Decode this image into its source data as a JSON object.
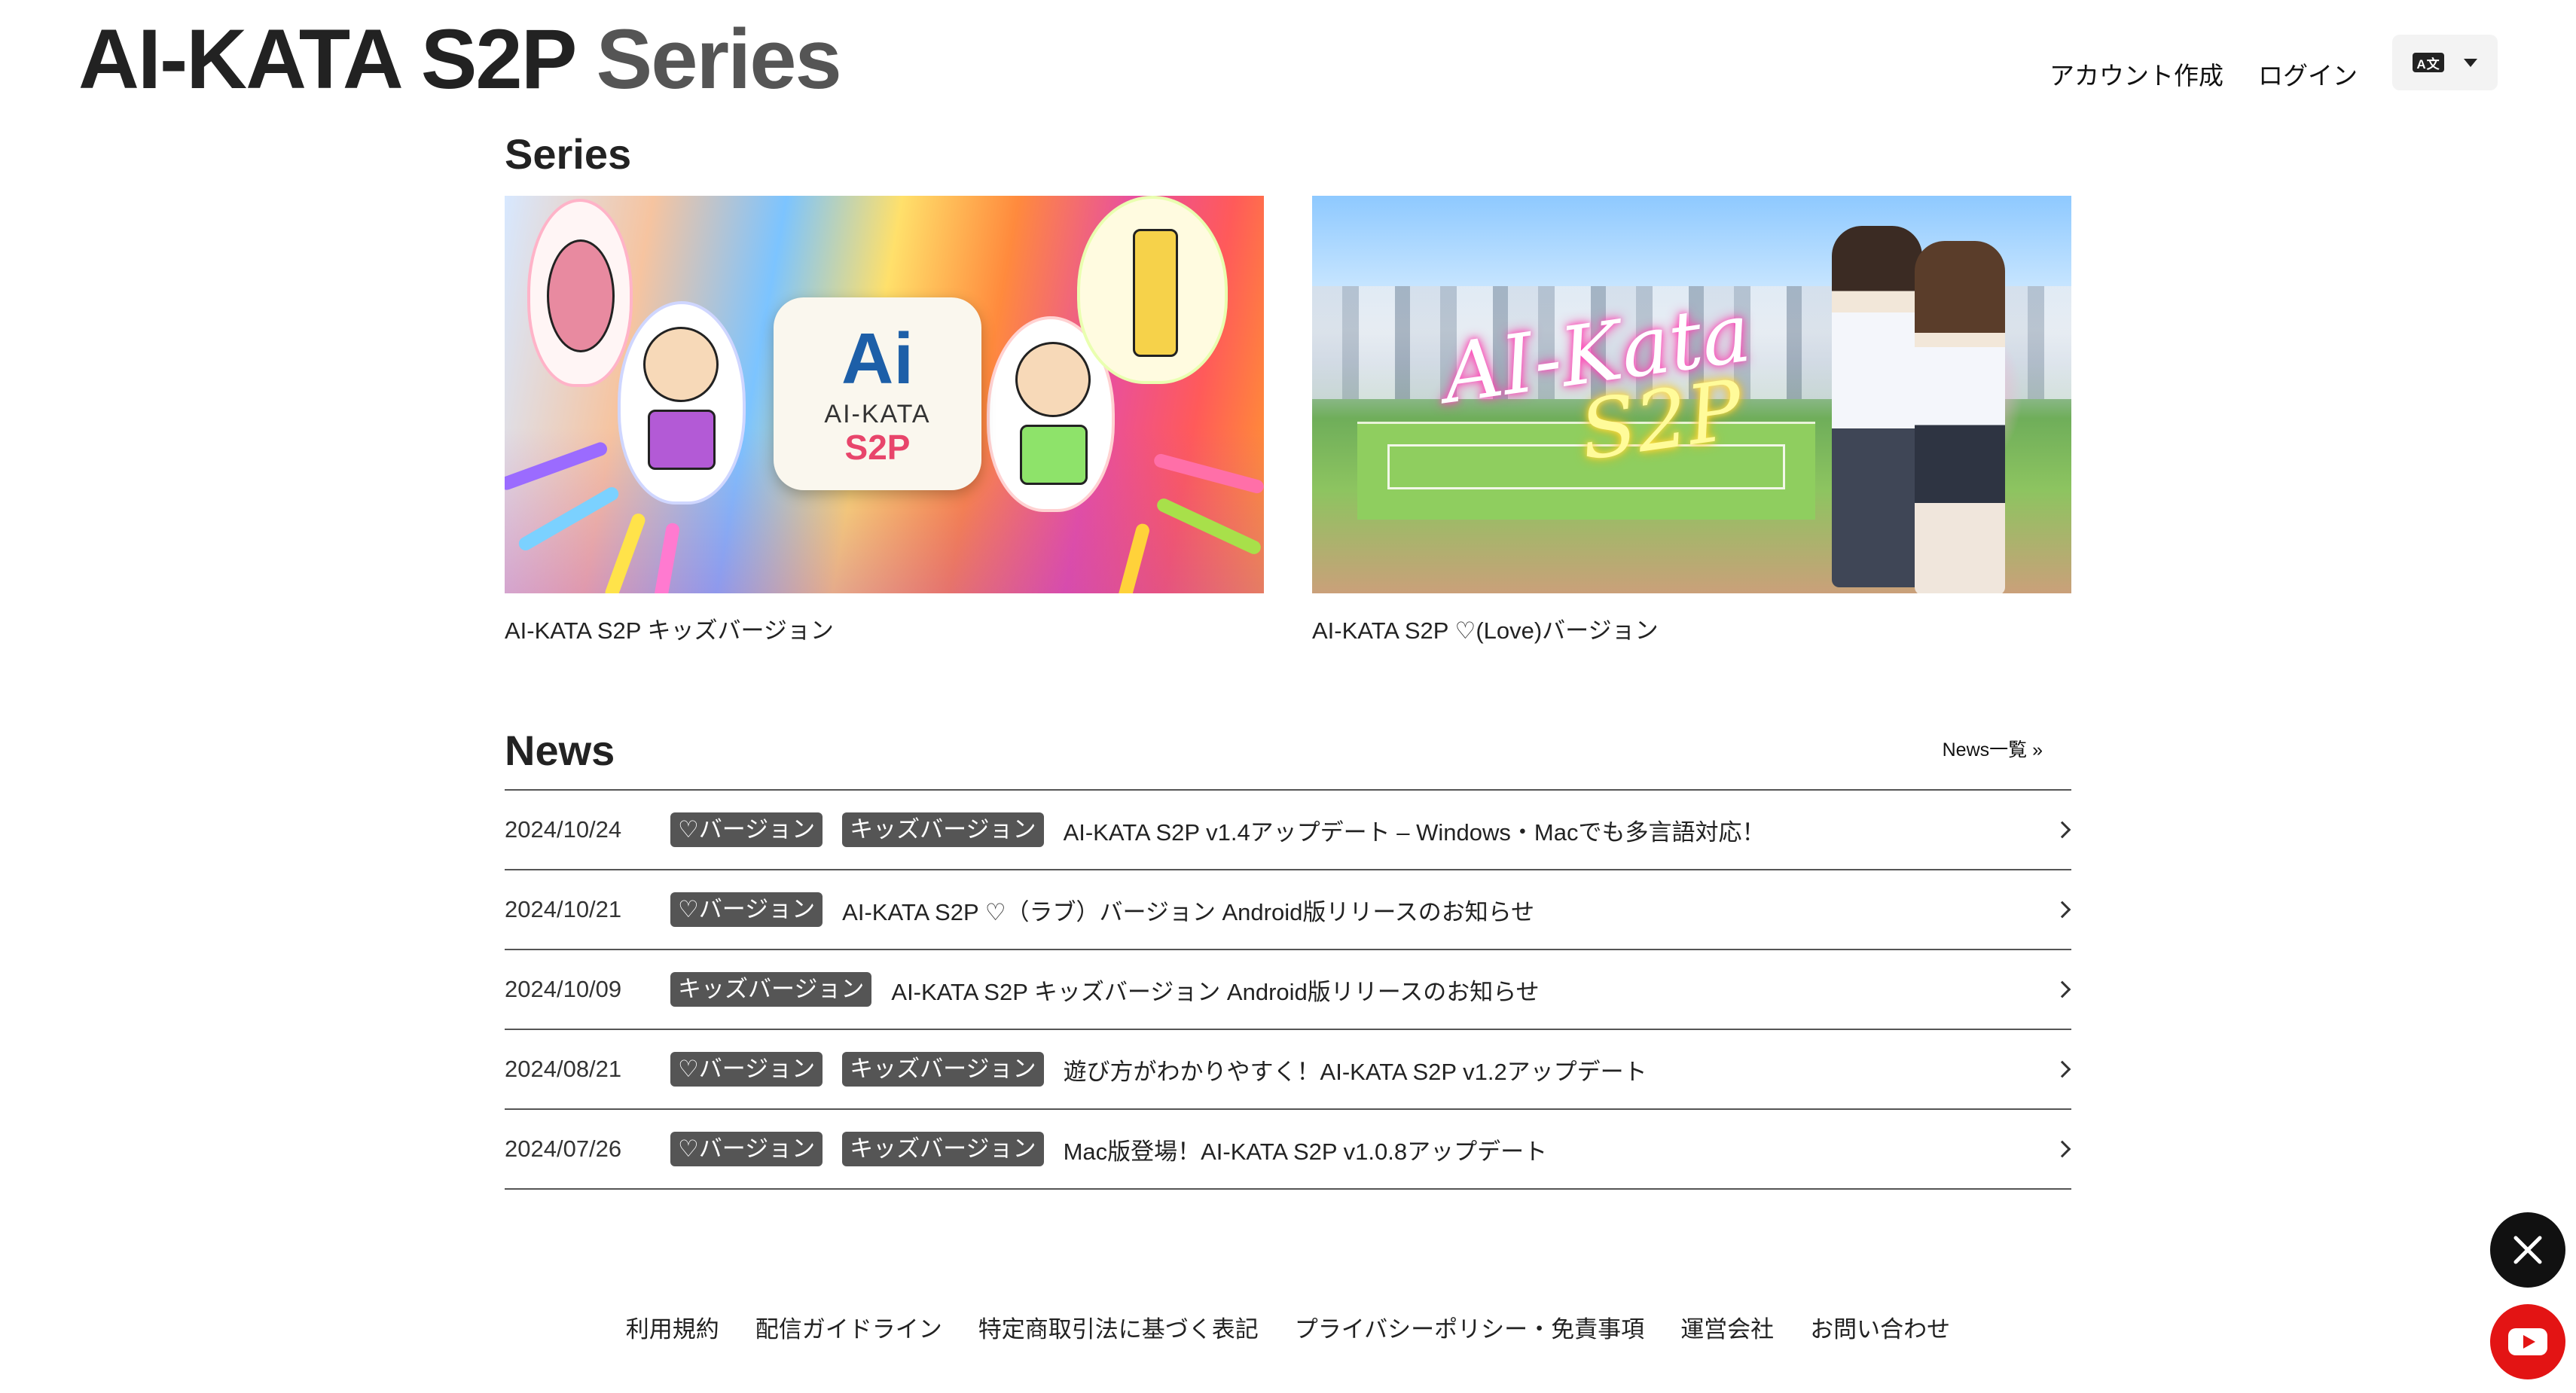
{
  "header": {
    "logo_main": "AI-KATA S2P",
    "logo_sub": "Series",
    "nav": {
      "signup": "アカウント作成",
      "login": "ログイン",
      "lang_icon": "A文"
    }
  },
  "series": {
    "title": "Series",
    "items": [
      {
        "caption": "AI-KATA S2P キッズバージョン",
        "art_text": {
          "big": "Ai",
          "mid": "AI-KATA",
          "s2p": "S2P"
        }
      },
      {
        "caption": "AI-KATA S2P ♡(Love)バージョン",
        "art_text": {
          "line1": "AI-Kata",
          "line2": "S2P"
        }
      }
    ]
  },
  "news": {
    "title": "News",
    "all_link": "News一覧 »",
    "items": [
      {
        "date": "2024/10/24",
        "tags": [
          "♡バージョン",
          "キッズバージョン"
        ],
        "title": "AI-KATA S2P v1.4アップデート – Windows・Macでも多言語対応！"
      },
      {
        "date": "2024/10/21",
        "tags": [
          "♡バージョン"
        ],
        "title": "AI-KATA S2P ♡（ラブ）バージョン Android版リリースのお知らせ"
      },
      {
        "date": "2024/10/09",
        "tags": [
          "キッズバージョン"
        ],
        "title": "AI-KATA S2P キッズバージョン Android版リリースのお知らせ"
      },
      {
        "date": "2024/08/21",
        "tags": [
          "♡バージョン",
          "キッズバージョン"
        ],
        "title": "遊び方がわかりやすく！AI-KATA S2P v1.2アップデート"
      },
      {
        "date": "2024/07/26",
        "tags": [
          "♡バージョン",
          "キッズバージョン"
        ],
        "title": "Mac版登場！AI-KATA S2P v1.0.8アップデート"
      }
    ]
  },
  "footer": {
    "links": [
      "利用規約",
      "配信ガイドライン",
      "特定商取引法に基づく表記",
      "プライバシーポリシー・免責事項",
      "運営会社",
      "お問い合わせ"
    ]
  },
  "social": {
    "x_label": "𝕏"
  },
  "colors": {
    "tag_bg": "#555555",
    "youtube": "#e31414",
    "x": "#111111"
  }
}
